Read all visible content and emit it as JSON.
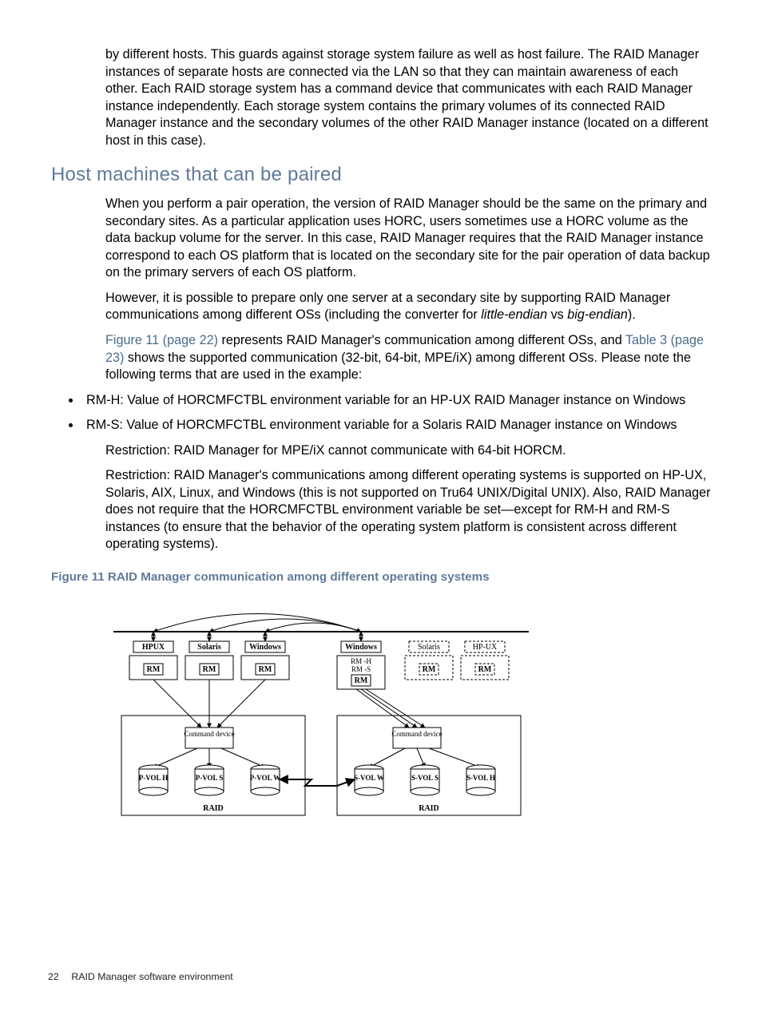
{
  "para_top": "by different hosts. This guards against storage system failure as well as host failure. The RAID Manager instances of separate hosts are connected via the LAN so that they can maintain awareness of each other. Each RAID storage system has a command device that communicates with each RAID Manager instance independently. Each storage system contains the primary volumes of its connected RAID Manager instance and the secondary volumes of the other RAID Manager instance (located on a different host in this case).",
  "heading": "Host machines that can be paired",
  "para1": "When you perform a pair operation, the version of RAID Manager should be the same on the primary and secondary sites. As a particular application uses HORC, users sometimes use a HORC volume as the data backup volume for the server. In this case, RAID Manager requires that the RAID Manager instance correspond to each OS platform that is located on the secondary site for the pair operation of data backup on the primary servers of each OS platform.",
  "para2_a": "However, it is possible to prepare only one server at a secondary site by supporting RAID Manager communications among different OSs (including the converter for ",
  "para2_le": "little-endian",
  "para2_vs": " vs ",
  "para2_be": "big-endian",
  "para2_b": ").",
  "para3_link1": "Figure 11 (page 22)",
  "para3_mid1": " represents RAID Manager's communication among different OSs, and ",
  "para3_link2": "Table 3 (page 23)",
  "para3_mid2": " shows the supported communication (32-bit, 64-bit, MPE/iX) among different OSs. Please note the following terms that are used in the example:",
  "bullet1": "RM-H: Value of HORCMFCTBL environment variable for an HP-UX RAID Manager instance on Windows",
  "bullet2": "RM-S: Value of HORCMFCTBL environment variable for a Solaris RAID Manager instance on Windows",
  "para4": "Restriction: RAID Manager for MPE/iX cannot communicate with 64-bit HORCM.",
  "para5": "Restriction: RAID Manager's communications among different operating systems is supported on HP-UX, Solaris, AIX, Linux, and Windows (this is not supported on Tru64 UNIX/Digital UNIX). Also, RAID Manager does not require that the HORCMFCTBL environment variable be set—except for RM-H and RM-S instances (to ensure that the behavior of the operating system platform is consistent across different operating systems).",
  "figure_caption": "Figure 11 RAID Manager communication among different operating systems",
  "diagram": {
    "hosts_left": [
      {
        "os": "HPUX",
        "box": "RM"
      },
      {
        "os": "Solaris",
        "box": "RM"
      },
      {
        "os": "Windows",
        "box": "RM"
      }
    ],
    "host_center": {
      "os": "Windows",
      "lines": [
        "RM -H",
        "RM -S"
      ],
      "box": "RM"
    },
    "hosts_right": [
      {
        "os": "Solaris",
        "box": "RM"
      },
      {
        "os": "HP-UX",
        "box": "RM"
      }
    ],
    "cmd_dev": "Command device",
    "raid_label": "RAID",
    "pvol": [
      "P-VOL H",
      "P-VOL S",
      "P-VOL W"
    ],
    "svol": [
      "S-VOL W",
      "S-VOL S",
      "S-VOL H"
    ]
  },
  "footer_page": "22",
  "footer_text": "RAID Manager software environment"
}
